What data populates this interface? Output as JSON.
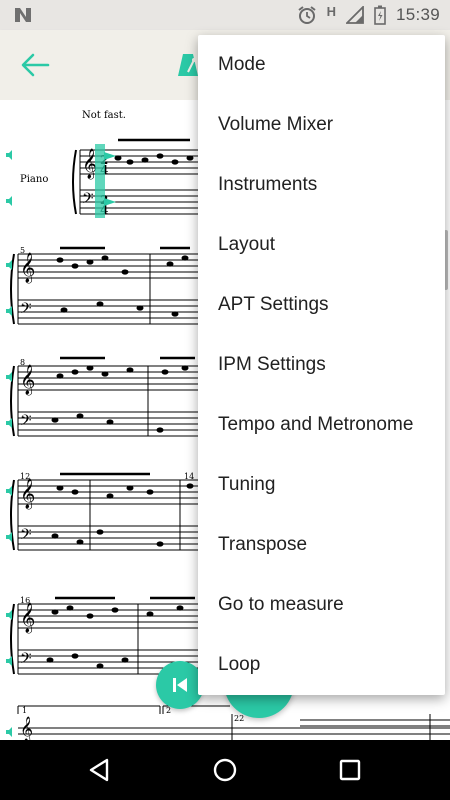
{
  "status_bar": {
    "time": "15:39",
    "icons": [
      "n-logo-icon",
      "alarm-icon",
      "h-signal-icon",
      "signal-icon",
      "battery-icon"
    ],
    "network_label": "H"
  },
  "toolbar": {
    "back_icon": "arrow-left-icon",
    "metronome_icon": "metronome-icon",
    "accent_color": "#2bc9a6"
  },
  "score": {
    "tempo_text": "Not fast.",
    "instrument_label": "Piano",
    "measure_numbers": [
      "5",
      "8",
      "12",
      "14",
      "16",
      "22"
    ],
    "ending_labels": [
      "1",
      "2"
    ]
  },
  "menu": {
    "items": [
      "Mode",
      "Volume Mixer",
      "Instruments",
      "Layout",
      "APT Settings",
      "IPM Settings",
      "Tempo and Metronome",
      "Tuning",
      "Transpose",
      "Go to measure",
      "Loop"
    ]
  },
  "fab": {
    "prev_icon": "skip-to-start-icon",
    "play_icon": "play-icon"
  },
  "nav_bar": {
    "icons": [
      "back-triangle-icon",
      "home-circle-icon",
      "recents-square-icon"
    ]
  }
}
